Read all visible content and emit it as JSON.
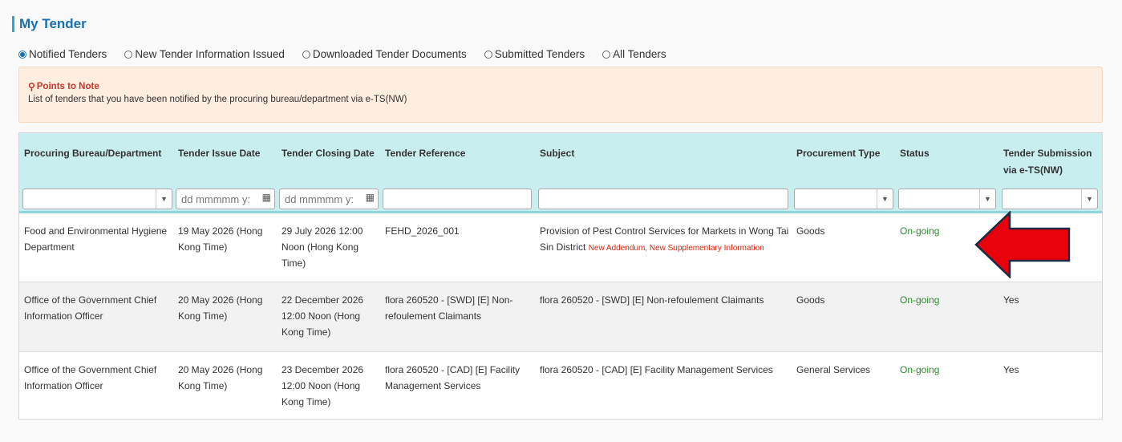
{
  "page": {
    "title": "My Tender"
  },
  "filters": {
    "options": [
      {
        "label": "Notified Tenders",
        "selected": true
      },
      {
        "label": "New Tender Information Issued",
        "selected": false
      },
      {
        "label": "Downloaded Tender Documents",
        "selected": false
      },
      {
        "label": "Submitted Tenders",
        "selected": false
      },
      {
        "label": "All Tenders",
        "selected": false
      }
    ]
  },
  "note": {
    "title": "Points to Note",
    "text": "List of tenders that you have been notified by the procuring bureau/department via e-TS(NW)"
  },
  "table": {
    "headers": [
      "Procuring Bureau/Department",
      "Tender Issue Date",
      "Tender Closing Date",
      "Tender Reference",
      "Subject",
      "Procurement Type",
      "Status",
      "Tender Submission via e-TS(NW)"
    ],
    "filter_placeholders": {
      "issue_date": "dd mmmmm y:",
      "closing_date": "dd mmmmm y:"
    },
    "rows": [
      {
        "bureau": "Food and Environmental Hygiene Department",
        "issue_date": "19 May 2026 (Hong Kong Time)",
        "closing_date": "29 July 2026 12:00 Noon (Hong Kong Time)",
        "reference": "FEHD_2026_001",
        "subject": "Provision of Pest Control Services for Markets in Wong Tai Sin District",
        "subject_tags": "New Addendum, New Supplementary Information",
        "type": "Goods",
        "status": "On-going",
        "submission": ""
      },
      {
        "bureau": "Office of the Government Chief Information Officer",
        "issue_date": "20 May 2026 (Hong Kong Time)",
        "closing_date": "22 December 2026 12:00 Noon (Hong Kong Time)",
        "reference": "flora 260520 - [SWD] [E] Non-refoulement Claimants",
        "subject": "flora 260520 - [SWD] [E] Non-refoulement Claimants",
        "subject_tags": "",
        "type": "Goods",
        "status": "On-going",
        "submission": "Yes"
      },
      {
        "bureau": "Office of the Government Chief Information Officer",
        "issue_date": "20 May 2026 (Hong Kong Time)",
        "closing_date": "23 December 2026 12:00 Noon (Hong Kong Time)",
        "reference": "flora 260520 - [CAD] [E] Facility Management Services",
        "subject": "flora 260520 - [CAD] [E] Facility Management Services",
        "subject_tags": "",
        "type": "General Services",
        "status": "On-going",
        "submission": "Yes"
      }
    ]
  },
  "colors": {
    "accent": "#1a6fad",
    "header_bg": "#c9eef0",
    "status": "#2e8b2e",
    "tag": "#d9230f",
    "arrow": "#e8000b"
  }
}
